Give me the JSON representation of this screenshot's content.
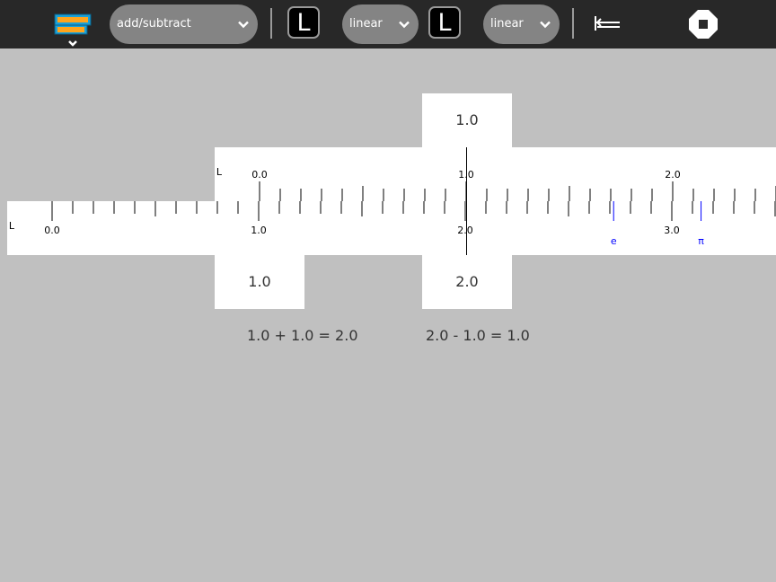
{
  "toolbar": {
    "function_select": "add/subtract",
    "top_scale_label": "L",
    "top_scale_type": "linear",
    "bottom_scale_label": "L",
    "bottom_scale_type": "linear"
  },
  "slide_scale": {
    "name": "L",
    "labels": [
      "0.0",
      "1.0",
      "2.0"
    ],
    "read_value": "1.0"
  },
  "stock_scale": {
    "name": "L",
    "labels": [
      "0.0",
      "1.0",
      "2.0",
      "3.0"
    ],
    "constants": [
      "e",
      "π"
    ],
    "read_value_left": "1.0",
    "read_value_right": "2.0"
  },
  "results": {
    "addition": "1.0 + 1.0 = 2.0",
    "subtraction": "2.0 - 1.0 = 1.0"
  },
  "colors": {
    "toolbar_bg": "#282828",
    "constant_marker": "#0000ff",
    "background": "#c0c0c0"
  }
}
